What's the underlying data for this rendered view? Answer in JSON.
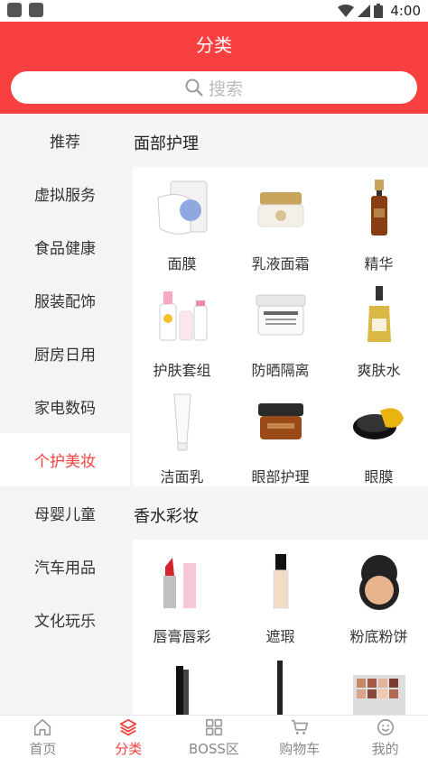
{
  "status_bar": {
    "time": "4:00",
    "battery": "8"
  },
  "header": {
    "title": "分类",
    "search_placeholder": "搜索"
  },
  "colors": {
    "accent": "#f84040",
    "active_text": "#f84040"
  },
  "sidebar": {
    "items": [
      {
        "label": "推荐"
      },
      {
        "label": "虚拟服务"
      },
      {
        "label": "食品健康"
      },
      {
        "label": "服装配饰"
      },
      {
        "label": "厨房日用"
      },
      {
        "label": "家电数码"
      },
      {
        "label": "个护美妆",
        "active": true
      },
      {
        "label": "母婴儿童"
      },
      {
        "label": "汽车用品"
      },
      {
        "label": "文化玩乐"
      }
    ]
  },
  "sections": [
    {
      "title": "面部护理",
      "items": [
        {
          "label": "面膜",
          "icon": "face-mask-product"
        },
        {
          "label": "乳液面霜",
          "icon": "cream-jar-product"
        },
        {
          "label": "精华",
          "icon": "serum-bottle-product"
        },
        {
          "label": "护肤套组",
          "icon": "skincare-set-product"
        },
        {
          "label": "防晒隔离",
          "icon": "sunscreen-jar-product"
        },
        {
          "label": "爽肤水",
          "icon": "toner-bottle-product"
        },
        {
          "label": "洁面乳",
          "icon": "cleanser-tube-product"
        },
        {
          "label": "眼部护理",
          "icon": "eye-cream-jar-product"
        },
        {
          "label": "眼膜",
          "icon": "eye-mask-jar-product"
        }
      ]
    },
    {
      "title": "香水彩妆",
      "items": [
        {
          "label": "唇膏唇彩",
          "icon": "lipstick-product"
        },
        {
          "label": "遮瑕",
          "icon": "concealer-bottle-product"
        },
        {
          "label": "粉底粉饼",
          "icon": "compact-powder-product"
        },
        {
          "label": "",
          "icon": "mascara-product"
        },
        {
          "label": "",
          "icon": "eyeliner-pencil-product"
        },
        {
          "label": "",
          "icon": "eyeshadow-palette-product"
        }
      ]
    }
  ],
  "bottom_nav": [
    {
      "label": "首页",
      "icon": "home-icon"
    },
    {
      "label": "分类",
      "icon": "category-layers-icon",
      "active": true
    },
    {
      "label": "BOSS区",
      "icon": "grid-icon"
    },
    {
      "label": "购物车",
      "icon": "cart-icon"
    },
    {
      "label": "我的",
      "icon": "smiley-icon"
    }
  ]
}
